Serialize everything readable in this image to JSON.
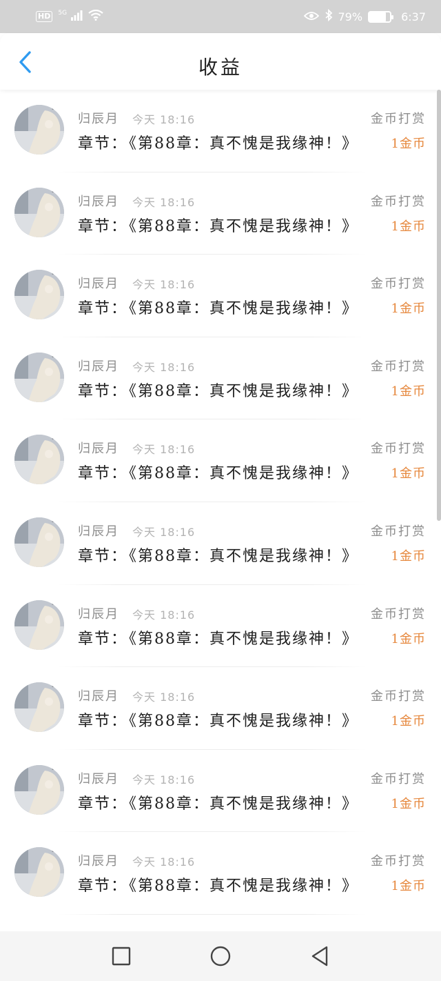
{
  "status_bar": {
    "hd": "HD",
    "network": "5G",
    "battery_pct": "79%",
    "battery_level": 0.79,
    "time": "6:37",
    "icons": [
      "hd-icon",
      "signal-icon",
      "wifi-icon",
      "eye-icon",
      "bluetooth-icon",
      "battery-icon"
    ]
  },
  "header": {
    "title": "收益",
    "back_icon": "chevron-left-icon",
    "accent": "#2f9bf0"
  },
  "colors": {
    "amount": "#e6873c",
    "muted": "#8d8d8d"
  },
  "items": [
    {
      "name": "归辰月",
      "time": "今天 18:16",
      "chapter_prefix": "章节：",
      "chapter": "《第88章：真不愧是我缘神！》",
      "tip_type": "金币打赏",
      "amount": "1金币"
    },
    {
      "name": "归辰月",
      "time": "今天 18:16",
      "chapter_prefix": "章节：",
      "chapter": "《第88章：真不愧是我缘神！》",
      "tip_type": "金币打赏",
      "amount": "1金币"
    },
    {
      "name": "归辰月",
      "time": "今天 18:16",
      "chapter_prefix": "章节：",
      "chapter": "《第88章：真不愧是我缘神！》",
      "tip_type": "金币打赏",
      "amount": "1金币"
    },
    {
      "name": "归辰月",
      "time": "今天 18:16",
      "chapter_prefix": "章节：",
      "chapter": "《第88章：真不愧是我缘神！》",
      "tip_type": "金币打赏",
      "amount": "1金币"
    },
    {
      "name": "归辰月",
      "time": "今天 18:16",
      "chapter_prefix": "章节：",
      "chapter": "《第88章：真不愧是我缘神！》",
      "tip_type": "金币打赏",
      "amount": "1金币"
    },
    {
      "name": "归辰月",
      "time": "今天 18:16",
      "chapter_prefix": "章节：",
      "chapter": "《第88章：真不愧是我缘神！》",
      "tip_type": "金币打赏",
      "amount": "1金币"
    },
    {
      "name": "归辰月",
      "time": "今天 18:16",
      "chapter_prefix": "章节：",
      "chapter": "《第88章：真不愧是我缘神！》",
      "tip_type": "金币打赏",
      "amount": "1金币"
    },
    {
      "name": "归辰月",
      "time": "今天 18:16",
      "chapter_prefix": "章节：",
      "chapter": "《第88章：真不愧是我缘神！》",
      "tip_type": "金币打赏",
      "amount": "1金币"
    },
    {
      "name": "归辰月",
      "time": "今天 18:16",
      "chapter_prefix": "章节：",
      "chapter": "《第88章：真不愧是我缘神！》",
      "tip_type": "金币打赏",
      "amount": "1金币"
    },
    {
      "name": "归辰月",
      "time": "今天 18:16",
      "chapter_prefix": "章节：",
      "chapter": "《第88章：真不愧是我缘神！》",
      "tip_type": "金币打赏",
      "amount": "1金币"
    }
  ],
  "nav_bar": {
    "icons": [
      "recents-square-icon",
      "home-circle-icon",
      "back-triangle-icon"
    ]
  }
}
